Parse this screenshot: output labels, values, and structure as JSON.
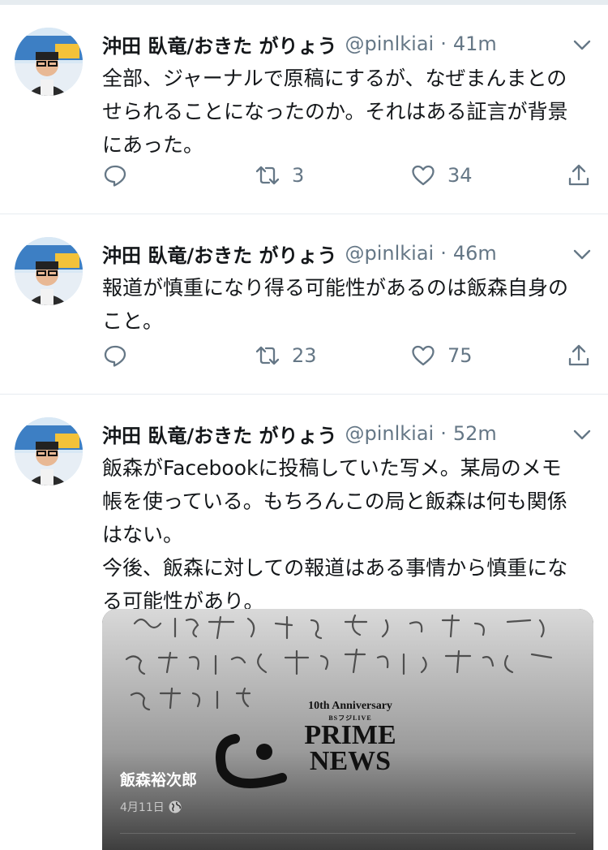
{
  "tweets": [
    {
      "name": "沖田 臥竜/おきた がりょう",
      "handle": "@pinlkiai",
      "separator": "·",
      "time": "41m",
      "lines": [
        "全部、ジャーナルで原稿にするが、なぜまんまとの",
        "せられることになったのか。それはある証言が背景",
        "にあった。"
      ],
      "retweets": "3",
      "likes": "34"
    },
    {
      "name": "沖田 臥竜/おきた がりょう",
      "handle": "@pinlkiai",
      "separator": "·",
      "time": "46m",
      "lines": [
        "報道が慎重になり得る可能性があるのは飯森自身の",
        "こと。"
      ],
      "retweets": "23",
      "likes": "75"
    },
    {
      "name": "沖田 臥竜/おきた がりょう",
      "handle": "@pinlkiai",
      "separator": "·",
      "time": "52m",
      "lines": [
        "飯森がFacebookに投稿していた写メ。某局のメモ",
        "帳を使っている。もちろんこの局と飯森は何も関係",
        "はない。",
        "今後、飯森に対しての報道はある事情から慎重にな",
        "る可能性があり。"
      ],
      "media": {
        "handwriting_lines": [
          "評価を得る。左辺を計算すると3.001...",
          "となるので、円周率が3.05より大きいことが",
          "証明された。"
        ],
        "watermark_top": "10th Anniversary",
        "watermark_sub": "BSフジLIVE",
        "watermark_main1": "PRIME",
        "watermark_main2": "NEWS",
        "poster_name": "飯森裕次郎",
        "post_date": "4月11日"
      }
    }
  ],
  "colors": {
    "text": "#14171a",
    "secondary": "#657786",
    "divider": "#e6ecf0"
  },
  "icons": {
    "reply": "reply-icon",
    "retweet": "retweet-icon",
    "like": "heart-icon",
    "share": "share-icon",
    "caret": "chevron-down-icon",
    "globe": "globe-icon"
  }
}
